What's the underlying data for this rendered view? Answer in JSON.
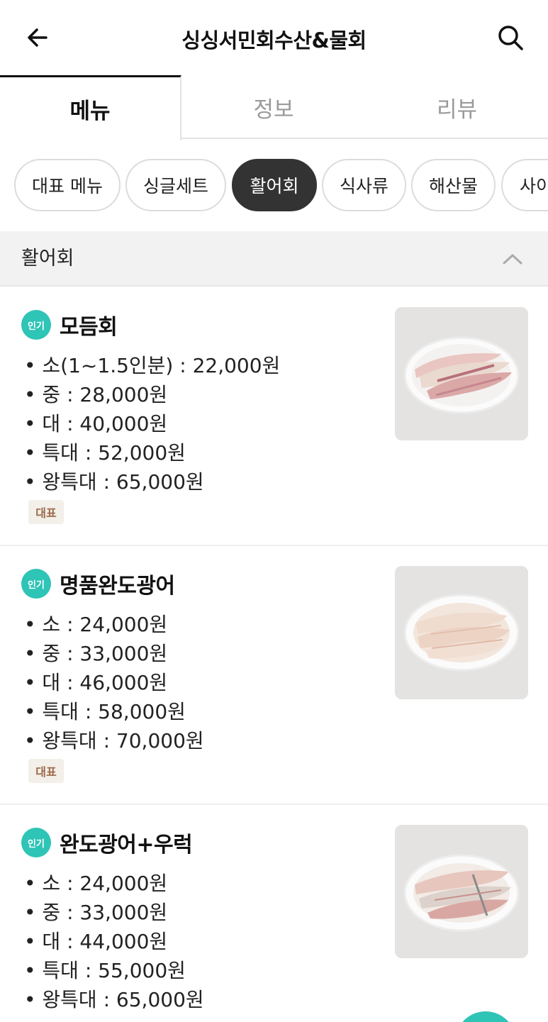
{
  "header": {
    "title": "싱싱서민회수산&물회",
    "back_icon": "arrow-left-icon",
    "search_icon": "search-icon"
  },
  "tabs": [
    {
      "label": "메뉴",
      "active": true
    },
    {
      "label": "정보",
      "active": false
    },
    {
      "label": "리뷰",
      "active": false
    }
  ],
  "categories": [
    {
      "label": "대표 메뉴",
      "active": false
    },
    {
      "label": "싱글세트",
      "active": false
    },
    {
      "label": "활어회",
      "active": true
    },
    {
      "label": "식사류",
      "active": false
    },
    {
      "label": "해산물",
      "active": false
    },
    {
      "label": "사이",
      "active": false
    }
  ],
  "section": {
    "title": "활어회",
    "collapse_icon": "chevron-up-icon"
  },
  "items": [
    {
      "badge": "인기",
      "name": "모듬회",
      "prices": [
        "• 소(1~1.5인분) : 22,000원",
        "• 중 : 28,000원",
        "• 대 : 40,000원",
        "• 특대 : 52,000원",
        "• 왕특대 : 65,000원"
      ],
      "tag": "대표"
    },
    {
      "badge": "인기",
      "name": "명품완도광어",
      "prices": [
        "• 소 : 24,000원",
        "• 중 : 33,000원",
        "• 대 : 46,000원",
        "• 특대 : 58,000원",
        "• 왕특대 : 70,000원"
      ],
      "tag": "대표"
    },
    {
      "badge": "인기",
      "name": "완도광어+우럭",
      "prices": [
        "• 소 : 24,000원",
        "• 중 : 33,000원",
        "• 대 : 44,000원",
        "• 특대 : 55,000원",
        "• 왕특대 : 65,000원"
      ]
    }
  ],
  "colors": {
    "accent": "#2ec4b6",
    "chip_active": "#333333",
    "tag_text": "#9b6a4a",
    "tag_bg": "#f3efe9"
  }
}
